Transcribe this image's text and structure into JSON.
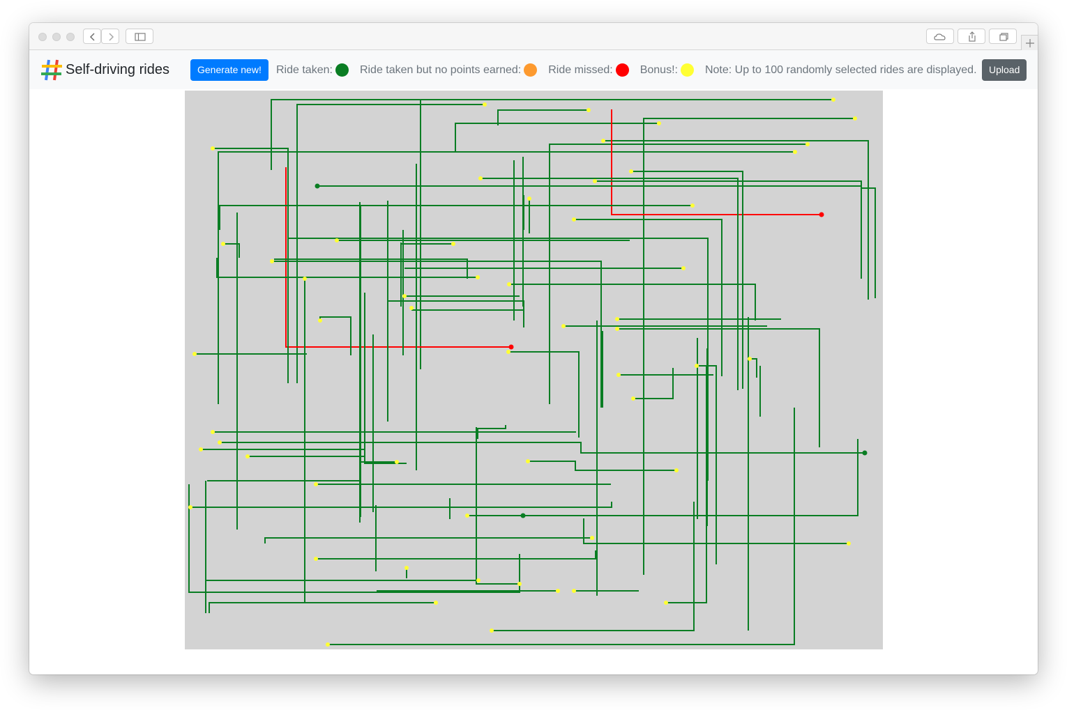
{
  "header": {
    "title": "Self-driving rides",
    "generate_label": "Generate new!",
    "upload_label": "Upload"
  },
  "legend": {
    "items": [
      {
        "label": "Ride taken:",
        "color": "#0a7d23"
      },
      {
        "label": "Ride taken but no points earned:",
        "color": "#fd9a2f"
      },
      {
        "label": "Ride missed:",
        "color": "#ff0000"
      },
      {
        "label": "Bonus!:",
        "color": "#ffff33"
      }
    ],
    "note": "Note: Up to 100 randomly selected rides are displayed."
  },
  "colors": {
    "taken": "#0a7d23",
    "missed": "#ff0000",
    "bonus": "#ffff33",
    "map_background": "#d3d3d3",
    "primary": "#007bff",
    "secondary": "#5a6268"
  },
  "rides": [
    {
      "s": "taken",
      "p": [
        [
          124,
          114
        ],
        [
          124,
          13
        ],
        [
          930,
          13
        ]
      ],
      "e": "bonus"
    },
    {
      "s": "taken",
      "p": [
        [
          161,
          420
        ],
        [
          161,
          20
        ],
        [
          430,
          20
        ]
      ],
      "e": "bonus"
    },
    {
      "s": "taken",
      "p": [
        [
          338,
          400
        ],
        [
          338,
          12
        ]
      ]
    },
    {
      "s": "taken",
      "p": [
        [
          449,
          50
        ],
        [
          449,
          28
        ],
        [
          579,
          28
        ]
      ],
      "e": "bonus"
    },
    {
      "s": "taken",
      "p": [
        [
          388,
          88
        ],
        [
          388,
          47
        ],
        [
          680,
          47
        ]
      ],
      "e": "bonus"
    },
    {
      "s": "taken",
      "p": [
        [
          658,
          680
        ],
        [
          658,
          40
        ],
        [
          961,
          40
        ]
      ],
      "e": "bonus"
    },
    {
      "s": "taken",
      "p": [
        [
          40,
          83
        ],
        [
          148,
          83
        ],
        [
          148,
          420
        ]
      ],
      "b": "bonus"
    },
    {
      "s": "taken",
      "p": [
        [
          48,
          450
        ],
        [
          48,
          88
        ],
        [
          875,
          88
        ]
      ],
      "e": "bonus"
    },
    {
      "s": "taken",
      "p": [
        [
          523,
          450
        ],
        [
          523,
          77
        ],
        [
          893,
          77
        ]
      ],
      "e": "bonus"
    },
    {
      "s": "taken",
      "p": [
        [
          600,
          72
        ],
        [
          980,
          72
        ],
        [
          980,
          300
        ]
      ],
      "b": "bonus"
    },
    {
      "s": "missed",
      "p": [
        [
          612,
          27
        ],
        [
          612,
          178
        ],
        [
          913,
          178
        ]
      ],
      "e": "missed"
    },
    {
      "s": "missed",
      "p": [
        [
          145,
          110
        ],
        [
          145,
          368
        ],
        [
          468,
          368
        ]
      ],
      "e": "missed"
    },
    {
      "s": "taken",
      "p": [
        [
          190,
          137
        ],
        [
          970,
          137
        ],
        [
          970,
          270
        ]
      ],
      "b": "taken"
    },
    {
      "s": "taken",
      "p": [
        [
          424,
          126
        ],
        [
          793,
          126
        ],
        [
          793,
          430
        ]
      ],
      "b": "bonus"
    },
    {
      "s": "taken",
      "p": [
        [
          588,
          130
        ],
        [
          970,
          130
        ],
        [
          970,
          140
        ],
        [
          990,
          140
        ],
        [
          990,
          298
        ]
      ],
      "b": "bonus"
    },
    {
      "s": "taken",
      "p": [
        [
          640,
          116
        ],
        [
          800,
          116
        ],
        [
          800,
          428
        ]
      ],
      "b": "bonus"
    },
    {
      "s": "taken",
      "p": [
        [
          50,
          200
        ],
        [
          50,
          165
        ],
        [
          728,
          165
        ]
      ],
      "e": "bonus"
    },
    {
      "s": "taken",
      "p": [
        [
          75,
          175
        ],
        [
          75,
          630
        ]
      ]
    },
    {
      "s": "taken",
      "p": [
        [
          486,
          150
        ],
        [
          486,
          200
        ]
      ]
    },
    {
      "s": "taken",
      "p": [
        [
          494,
          155
        ],
        [
          494,
          205
        ]
      ],
      "b": "bonus"
    },
    {
      "s": "taken",
      "p": [
        [
          558,
          185
        ],
        [
          770,
          185
        ],
        [
          770,
          410
        ]
      ],
      "b": "bonus"
    },
    {
      "s": "taken",
      "p": [
        [
          46,
          240
        ],
        [
          46,
          268
        ],
        [
          420,
          268
        ]
      ],
      "e": "bonus"
    },
    {
      "s": "taken",
      "p": [
        [
          55,
          220
        ],
        [
          78,
          220
        ],
        [
          78,
          240
        ]
      ],
      "b": "bonus"
    },
    {
      "s": "taken",
      "p": [
        [
          218,
          215
        ],
        [
          638,
          215
        ]
      ],
      "b": "bonus"
    },
    {
      "s": "taken",
      "p": [
        [
          148,
          212
        ],
        [
          148,
          410
        ]
      ]
    },
    {
      "s": "taken",
      "p": [
        [
          148,
          212
        ],
        [
          750,
          212
        ],
        [
          750,
          560
        ]
      ]
    },
    {
      "s": "taken",
      "p": [
        [
          125,
          245
        ],
        [
          402,
          245
        ]
      ],
      "b": "bonus"
    },
    {
      "s": "taken",
      "p": [
        [
          128,
          242
        ],
        [
          405,
          242
        ],
        [
          405,
          270
        ]
      ]
    },
    {
      "s": "taken",
      "p": [
        [
          310,
          220
        ],
        [
          385,
          220
        ]
      ],
      "e": "bonus"
    },
    {
      "s": "taken",
      "p": [
        [
          310,
          218
        ],
        [
          310,
          310
        ]
      ]
    },
    {
      "s": "taken",
      "p": [
        [
          315,
          255
        ],
        [
          715,
          255
        ]
      ],
      "e": "bonus"
    },
    {
      "s": "taken",
      "p": [
        [
          313,
          200
        ],
        [
          313,
          380
        ]
      ]
    },
    {
      "s": "taken",
      "p": [
        [
          320,
          245
        ],
        [
          597,
          245
        ],
        [
          597,
          455
        ]
      ]
    },
    {
      "s": "taken",
      "p": [
        [
          252,
          165
        ],
        [
          252,
          280
        ],
        [
          252,
          610
        ]
      ]
    },
    {
      "s": "taken",
      "p": [
        [
          291,
          158
        ],
        [
          291,
          475
        ]
      ]
    },
    {
      "s": "taken",
      "p": [
        [
          332,
          105
        ],
        [
          332,
          545
        ]
      ]
    },
    {
      "s": "taken",
      "p": [
        [
          251,
          160
        ],
        [
          251,
          540
        ],
        [
          251,
          620
        ]
      ]
    },
    {
      "s": "taken",
      "p": [
        [
          465,
          278
        ],
        [
          818,
          278
        ],
        [
          818,
          330
        ]
      ],
      "b": "bonus"
    },
    {
      "s": "taken",
      "p": [
        [
          472,
          100
        ],
        [
          472,
          330
        ]
      ]
    },
    {
      "s": "taken",
      "p": [
        [
          485,
          95
        ],
        [
          485,
          310
        ]
      ]
    },
    {
      "s": "taken",
      "p": [
        [
          315,
          295
        ],
        [
          480,
          295
        ]
      ],
      "b": "bonus"
    },
    {
      "s": "taken",
      "p": [
        [
          290,
          302
        ],
        [
          486,
          302
        ],
        [
          486,
          340
        ]
      ]
    },
    {
      "s": "taken",
      "p": [
        [
          325,
          312
        ],
        [
          326,
          315
        ],
        [
          485,
          315
        ]
      ],
      "b": "bonus"
    },
    {
      "s": "taken",
      "p": [
        [
          194,
          330
        ],
        [
          194,
          325
        ],
        [
          238,
          325
        ],
        [
          238,
          380
        ]
      ],
      "b": "bonus"
    },
    {
      "s": "taken",
      "p": [
        [
          172,
          270
        ],
        [
          172,
          335
        ],
        [
          172,
          735
        ]
      ],
      "b": "bonus"
    },
    {
      "s": "taken",
      "p": [
        [
          14,
          378
        ],
        [
          175,
          378
        ]
      ],
      "b": "bonus"
    },
    {
      "s": "taken",
      "p": [
        [
          258,
          290
        ],
        [
          258,
          535
        ],
        [
          318,
          535
        ]
      ]
    },
    {
      "s": "taken",
      "p": [
        [
          270,
          350
        ],
        [
          270,
          605
        ]
      ]
    },
    {
      "s": "taken",
      "p": [
        [
          543,
          338
        ],
        [
          835,
          338
        ]
      ],
      "b": "bonus"
    },
    {
      "s": "taken",
      "p": [
        [
          620,
          328
        ],
        [
          855,
          328
        ]
      ],
      "b": "bonus"
    },
    {
      "s": "taken",
      "p": [
        [
          620,
          342
        ],
        [
          910,
          342
        ],
        [
          910,
          512
        ]
      ],
      "b": "bonus"
    },
    {
      "s": "taken",
      "p": [
        [
          464,
          375
        ],
        [
          565,
          375
        ],
        [
          565,
          498
        ]
      ],
      "b": "bonus"
    },
    {
      "s": "taken",
      "p": [
        [
          622,
          408
        ],
        [
          758,
          408
        ]
      ],
      "b": "bonus"
    },
    {
      "s": "taken",
      "p": [
        [
          643,
          442
        ],
        [
          700,
          442
        ],
        [
          700,
          398
        ]
      ],
      "b": "bonus"
    },
    {
      "s": "taken",
      "p": [
        [
          734,
          395
        ],
        [
          762,
          395
        ],
        [
          762,
          680
        ]
      ],
      "b": "bonus"
    },
    {
      "s": "taken",
      "p": [
        [
          810,
          385
        ],
        [
          820,
          385
        ],
        [
          820,
          412
        ]
      ],
      "b": "bonus"
    },
    {
      "s": "taken",
      "p": [
        [
          591,
          330
        ],
        [
          591,
          725
        ]
      ]
    },
    {
      "s": "taken",
      "p": [
        [
          599,
          345
        ],
        [
          599,
          455
        ]
      ]
    },
    {
      "s": "taken",
      "p": [
        [
          658,
          345
        ],
        [
          658,
          695
        ]
      ]
    },
    {
      "s": "taken",
      "p": [
        [
          735,
          355
        ],
        [
          735,
          615
        ]
      ]
    },
    {
      "s": "taken",
      "p": [
        [
          749,
          370
        ],
        [
          749,
          625
        ]
      ]
    },
    {
      "s": "taken",
      "p": [
        [
          808,
          325
        ],
        [
          808,
          775
        ]
      ]
    },
    {
      "s": "taken",
      "p": [
        [
          825,
          395
        ],
        [
          825,
          468
        ]
      ]
    },
    {
      "s": "taken",
      "p": [
        [
          874,
          455
        ],
        [
          874,
          795
        ]
      ]
    },
    {
      "s": "taken",
      "p": [
        [
          40,
          490
        ],
        [
          561,
          490
        ]
      ],
      "b": "bonus"
    },
    {
      "s": "taken",
      "p": [
        [
          50,
          505
        ],
        [
          568,
          505
        ],
        [
          568,
          520
        ],
        [
          975,
          520
        ]
      ],
      "b": "bonus",
      "e": "taken"
    },
    {
      "s": "taken",
      "p": [
        [
          23,
          515
        ],
        [
          258,
          515
        ],
        [
          258,
          535
        ]
      ],
      "b": "bonus"
    },
    {
      "s": "taken",
      "p": [
        [
          90,
          525
        ],
        [
          258,
          525
        ]
      ],
      "b": "bonus"
    },
    {
      "s": "taken",
      "p": [
        [
          252,
          533
        ],
        [
          304,
          533
        ]
      ],
      "e": "bonus"
    },
    {
      "s": "taken",
      "p": [
        [
          492,
          532
        ],
        [
          560,
          532
        ],
        [
          560,
          545
        ],
        [
          705,
          545
        ]
      ],
      "b": "bonus",
      "e": "bonus"
    },
    {
      "s": "taken",
      "p": [
        [
          188,
          565
        ],
        [
          611,
          565
        ]
      ],
      "b": "bonus"
    },
    {
      "s": "taken",
      "p": [
        [
          32,
          560
        ],
        [
          252,
          560
        ],
        [
          252,
          612
        ]
      ]
    },
    {
      "s": "taken",
      "p": [
        [
          6,
          565
        ],
        [
          6,
          720
        ],
        [
          480,
          720
        ],
        [
          480,
          665
        ]
      ]
    },
    {
      "s": "taken",
      "p": [
        [
          30,
          560
        ],
        [
          30,
          750
        ]
      ]
    },
    {
      "s": "taken",
      "p": [
        [
          8,
          598
        ],
        [
          612,
          598
        ],
        [
          612,
          590
        ]
      ],
      "b": "bonus"
    },
    {
      "s": "taken",
      "p": [
        [
          380,
          585
        ],
        [
          380,
          615
        ]
      ]
    },
    {
      "s": "taken",
      "p": [
        [
          405,
          610
        ],
        [
          611,
          610
        ]
      ],
      "b": "bonus"
    },
    {
      "s": "taken",
      "p": [
        [
          420,
          500
        ],
        [
          420,
          485
        ],
        [
          460,
          485
        ],
        [
          460,
          480
        ]
      ]
    },
    {
      "s": "taken",
      "p": [
        [
          418,
          483
        ],
        [
          418,
          708
        ],
        [
          480,
          708
        ]
      ],
      "e": "bonus"
    },
    {
      "s": "taken",
      "p": [
        [
          485,
          610
        ],
        [
          965,
          610
        ],
        [
          965,
          500
        ]
      ],
      "b": "taken"
    },
    {
      "s": "taken",
      "p": [
        [
          572,
          614
        ],
        [
          572,
          650
        ],
        [
          952,
          650
        ]
      ],
      "e": "bonus"
    },
    {
      "s": "taken",
      "p": [
        [
          115,
          650
        ],
        [
          115,
          642
        ],
        [
          584,
          642
        ]
      ],
      "e": "bonus"
    },
    {
      "s": "taken",
      "p": [
        [
          188,
          672
        ],
        [
          589,
          672
        ],
        [
          589,
          660
        ]
      ],
      "b": "bonus"
    },
    {
      "s": "taken",
      "p": [
        [
          318,
          685
        ],
        [
          318,
          700
        ]
      ],
      "b": "bonus"
    },
    {
      "s": "taken",
      "p": [
        [
          31,
          703
        ],
        [
          421,
          703
        ]
      ],
      "e": "bonus"
    },
    {
      "s": "taken",
      "p": [
        [
          558,
          718
        ],
        [
          651,
          718
        ]
      ],
      "b": "bonus"
    },
    {
      "s": "taken",
      "p": [
        [
          275,
          718
        ],
        [
          535,
          718
        ]
      ],
      "e": "bonus"
    },
    {
      "s": "taken",
      "p": [
        [
          690,
          735
        ],
        [
          748,
          735
        ],
        [
          748,
          395
        ]
      ],
      "b": "bonus"
    },
    {
      "s": "taken",
      "p": [
        [
          440,
          775
        ],
        [
          730,
          775
        ],
        [
          730,
          590
        ]
      ],
      "b": "bonus"
    },
    {
      "s": "taken",
      "p": [
        [
          808,
          690
        ],
        [
          808,
          760
        ]
      ]
    },
    {
      "s": "taken",
      "p": [
        [
          205,
          795
        ],
        [
          874,
          795
        ],
        [
          874,
          455
        ]
      ],
      "b": "bonus"
    },
    {
      "s": "taken",
      "p": [
        [
          205,
          795
        ],
        [
          874,
          795
        ]
      ]
    },
    {
      "s": "taken",
      "p": [
        [
          35,
          750
        ],
        [
          35,
          735
        ],
        [
          230,
          735
        ],
        [
          360,
          735
        ]
      ],
      "e": "bonus"
    },
    {
      "s": "taken",
      "p": [
        [
          6,
          720
        ],
        [
          6,
          580
        ]
      ]
    },
    {
      "s": "taken",
      "p": [
        [
          274,
          595
        ],
        [
          274,
          690
        ]
      ]
    }
  ]
}
